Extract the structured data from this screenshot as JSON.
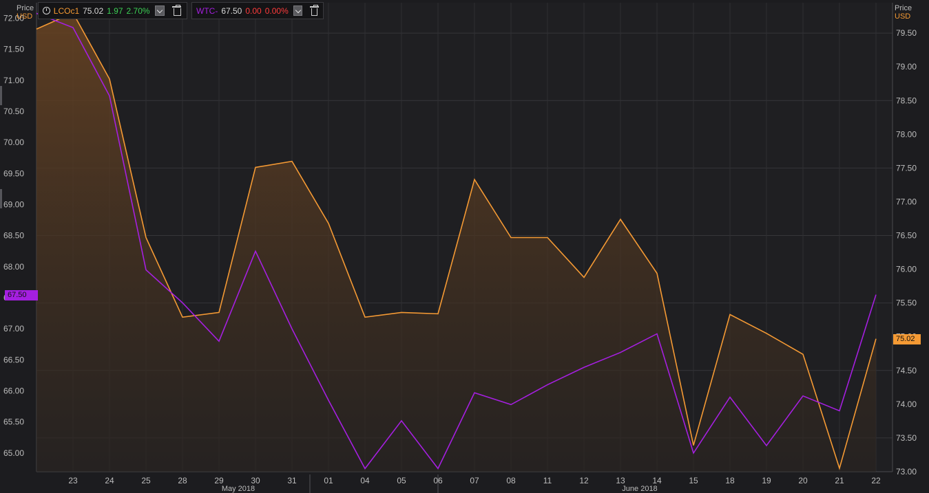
{
  "legend": [
    {
      "ric": "LCOc1",
      "last": "75.02",
      "change": "1.97",
      "pct": "2.70%",
      "color": "#f59a34",
      "change_color": "#3ccf55"
    },
    {
      "ric": "WTC-",
      "last": "67.50",
      "change": "0.00",
      "pct": "0.00%",
      "color": "#a51fe0",
      "change_color": "#ff3b3b"
    }
  ],
  "axis": {
    "left": {
      "title1": "Price",
      "title2": "USD",
      "last_value": "67.50"
    },
    "right": {
      "title1": "Price",
      "title2": "USD",
      "last_value": "75.02"
    }
  },
  "chart_data": {
    "type": "line",
    "x": [
      "22",
      "23",
      "24",
      "25",
      "28",
      "29",
      "30",
      "31",
      "01",
      "04",
      "05",
      "06",
      "07",
      "08",
      "11",
      "12",
      "13",
      "14",
      "15",
      "18",
      "19",
      "20",
      "21",
      "22"
    ],
    "x_tick_labels": [
      "23",
      "24",
      "25",
      "28",
      "29",
      "30",
      "31",
      "01",
      "04",
      "05",
      "06",
      "07",
      "08",
      "11",
      "12",
      "13",
      "14",
      "15",
      "18",
      "19",
      "20",
      "21",
      "22"
    ],
    "x_group_labels": [
      {
        "label": "May 2018",
        "at": "30"
      },
      {
        "label": "June 2018",
        "at": "14"
      }
    ],
    "left_axis": {
      "ylim": [
        64.7,
        72.25
      ],
      "ticks": [
        "65.00",
        "65.50",
        "66.00",
        "66.50",
        "67.00",
        "67.50",
        "68.00",
        "68.50",
        "69.00",
        "69.50",
        "70.00",
        "70.50",
        "71.00",
        "71.50",
        "72.00"
      ]
    },
    "right_axis": {
      "ylim": [
        73.0,
        79.95
      ],
      "ticks": [
        "73.00",
        "73.50",
        "74.00",
        "74.50",
        "75.00",
        "75.50",
        "76.00",
        "76.50",
        "77.00",
        "77.50",
        "78.00",
        "78.50",
        "79.00",
        "79.50"
      ]
    },
    "grid": true,
    "series": [
      {
        "name": "LCOc1",
        "axis": "right",
        "color": "#f59a34",
        "fill": true,
        "values": [
          79.56,
          79.8,
          78.82,
          76.47,
          75.29,
          75.36,
          77.51,
          77.6,
          76.68,
          75.29,
          75.36,
          75.34,
          77.33,
          76.47,
          76.47,
          75.88,
          76.74,
          75.94,
          73.39,
          75.33,
          75.05,
          74.74,
          73.05,
          74.97
        ]
      },
      {
        "name": "WTC-",
        "axis": "left",
        "color": "#a51fe0",
        "fill": false,
        "values": [
          72.08,
          71.85,
          70.75,
          67.95,
          67.42,
          66.8,
          68.25,
          67.0,
          65.85,
          64.75,
          65.52,
          64.75,
          65.97,
          65.78,
          66.1,
          66.38,
          66.62,
          66.92,
          65.0,
          65.9,
          65.12,
          65.92,
          65.68,
          67.55
        ]
      }
    ]
  }
}
